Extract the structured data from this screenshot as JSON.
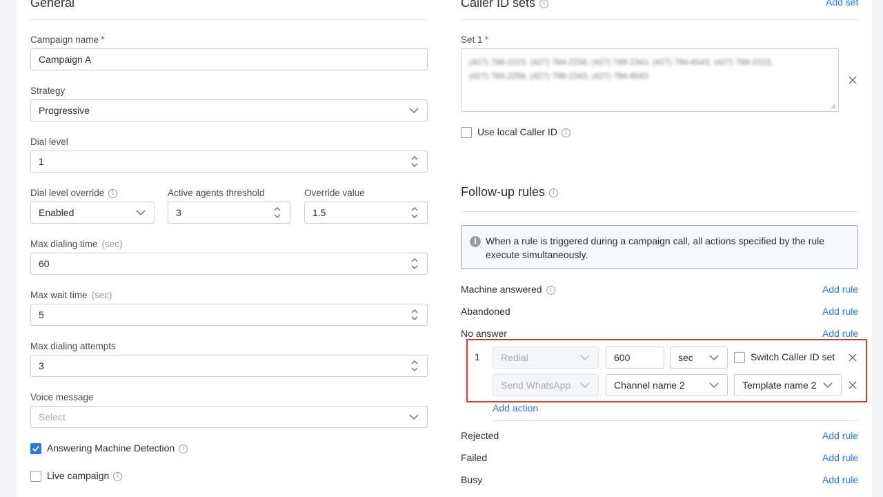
{
  "general": {
    "title": "General",
    "campaign_name": {
      "label": "Campaign name",
      "required": "*",
      "value": "Campaign A"
    },
    "strategy": {
      "label": "Strategy",
      "value": "Progressive"
    },
    "dial_level": {
      "label": "Dial level",
      "value": "1"
    },
    "dial_level_override": {
      "label": "Dial level override",
      "value": "Enabled"
    },
    "active_agents_threshold": {
      "label": "Active agents threshold",
      "value": "3"
    },
    "override_value": {
      "label": "Override value",
      "value": "1.5"
    },
    "max_dialing_time": {
      "label": "Max dialing time",
      "unit": "(sec)",
      "value": "60"
    },
    "max_wait_time": {
      "label": "Max wait time",
      "unit": "(sec)",
      "value": "5"
    },
    "max_dialing_attempts": {
      "label": "Max dialing attempts",
      "value": "3"
    },
    "voice_message": {
      "label": "Voice message",
      "placeholder": "Select"
    },
    "amd": {
      "label": "Answering Machine Detection",
      "checked": true
    },
    "live_campaign": {
      "label": "Live campaign",
      "checked": false
    }
  },
  "caller_id": {
    "title": "Caller ID sets",
    "add_set": "Add set",
    "set1": {
      "label": "Set 1",
      "required": "*",
      "line1": "(427) 788-2223, (427) 784-2256, (427) 789-2343, (427) 784-6543, (427) 788-2223,",
      "line2": "(427) 784-2256, (427) 788-2343, (427) 784-6543"
    },
    "use_local": {
      "label": "Use local Caller ID",
      "checked": false
    }
  },
  "followup": {
    "title": "Follow-up rules",
    "notice": "When a rule is triggered during a campaign call, all actions specified by the rule execute simultaneously.",
    "add_rule": "Add rule",
    "rules": {
      "machine_answered": "Machine answered",
      "abandoned": "Abandoned",
      "no_answer": "No answer",
      "rejected": "Rejected",
      "failed": "Failed",
      "busy": "Busy"
    },
    "no_answer_rule": {
      "index": "1",
      "action1": {
        "type": "Redial",
        "value": "600",
        "unit": "sec",
        "switch_label": "Switch Caller ID set",
        "switch_checked": false
      },
      "action2": {
        "type": "Send WhatsApp",
        "channel": "Channel name 2",
        "template": "Template name 2"
      },
      "add_action": "Add action"
    }
  },
  "colors": {
    "accent": "#2d78d8",
    "required": "#e0453a",
    "highlight": "#d93a2b"
  },
  "icons": [
    "chevron-down-icon",
    "spinner-arrows-icon",
    "info-icon",
    "close-icon",
    "check-icon",
    "resize-handle-icon"
  ]
}
